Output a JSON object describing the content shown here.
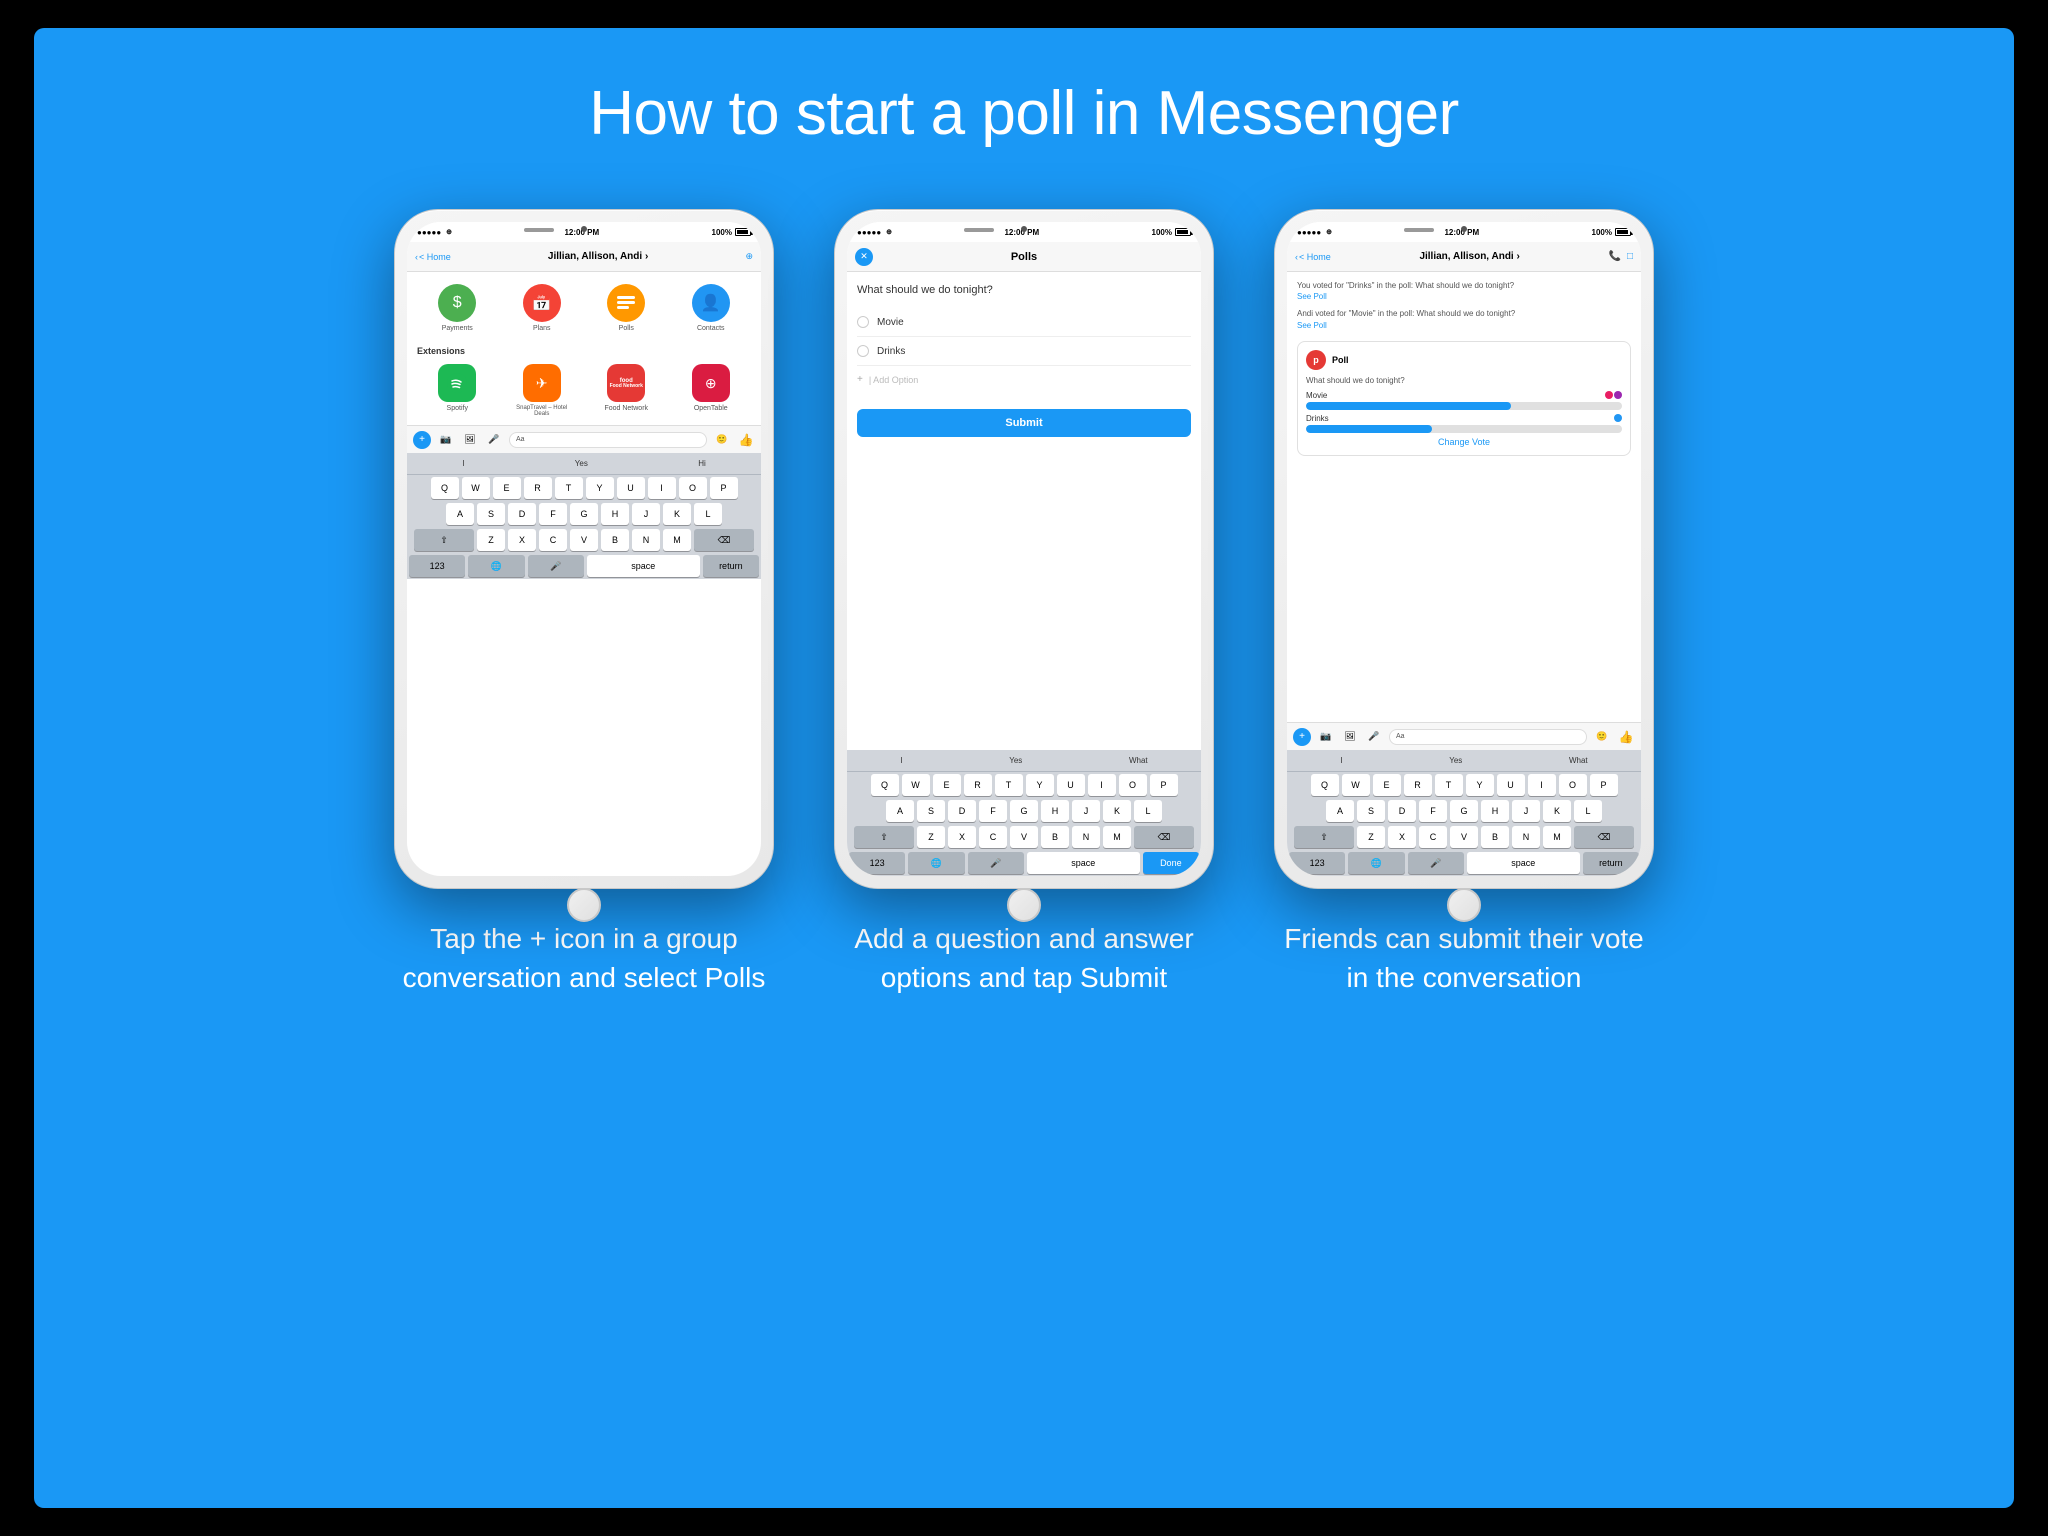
{
  "page": {
    "title": "How to start a poll in Messenger",
    "bg_color": "#1a98f5"
  },
  "phones": [
    {
      "id": "phone1",
      "caption": "Tap the + icon in a group conversation and select Polls",
      "status": {
        "left": "●●●●● ⊕",
        "time": "12:00 PM",
        "right": "100%"
      },
      "nav": {
        "back": "< Home",
        "title": "Jillian, Allison, Andi ›",
        "icons": "⊕"
      },
      "main_icons": [
        {
          "label": "Payments",
          "color": "#4caf50",
          "icon": "$"
        },
        {
          "label": "Plans",
          "color": "#f44336",
          "icon": "📅"
        },
        {
          "label": "Polls",
          "color": "#ff9800",
          "icon": "≡"
        },
        {
          "label": "Contacts",
          "color": "#2196f3",
          "icon": "👤"
        }
      ],
      "extensions_label": "Extensions",
      "extensions": [
        {
          "label": "Spotify",
          "color": "#1db954",
          "icon": "♫"
        },
        {
          "label": "SnapTravel – Hotel Deals",
          "color": "#ff6d00",
          "icon": "✈"
        },
        {
          "label": "Food Network",
          "color": "#e53935",
          "icon": "food"
        },
        {
          "label": "OpenTable",
          "color": "#da1c41",
          "icon": "⊕"
        }
      ],
      "keyboard": {
        "suggestions": [
          "I",
          "Yes",
          "Hi"
        ],
        "rows": [
          [
            "Q",
            "W",
            "E",
            "R",
            "T",
            "Y",
            "U",
            "I",
            "O",
            "P"
          ],
          [
            "A",
            "S",
            "D",
            "F",
            "G",
            "H",
            "J",
            "K",
            "L"
          ],
          [
            "⇧",
            "Z",
            "X",
            "C",
            "V",
            "B",
            "N",
            "M",
            "⌫"
          ],
          [
            "123",
            "🌐",
            "🎤",
            "space",
            "return"
          ]
        ]
      }
    },
    {
      "id": "phone2",
      "caption": "Add a question and answer options and tap Submit",
      "status": {
        "left": "●●●●● ⊕",
        "time": "12:00 PM",
        "right": "100%"
      },
      "polls_title": "Polls",
      "question": "What should we do tonight?",
      "options": [
        "Movie",
        "Drinks"
      ],
      "add_placeholder": "+ | Add Option",
      "submit_label": "Submit",
      "keyboard": {
        "suggestions": [
          "I",
          "Yes",
          "What"
        ],
        "rows": [
          [
            "Q",
            "W",
            "E",
            "R",
            "T",
            "Y",
            "U",
            "I",
            "O",
            "P"
          ],
          [
            "A",
            "S",
            "D",
            "F",
            "G",
            "H",
            "J",
            "K",
            "L"
          ],
          [
            "⇧",
            "Z",
            "X",
            "C",
            "V",
            "B",
            "N",
            "M",
            "⌫"
          ],
          [
            "123",
            "🌐",
            "🎤",
            "space",
            "Done"
          ]
        ]
      }
    },
    {
      "id": "phone3",
      "caption": "Friends can submit their vote in the conversation",
      "status": {
        "left": "●●●●● ⊕",
        "time": "12:00 PM",
        "right": "100%"
      },
      "nav": {
        "back": "< Home",
        "title": "Jillian, Allison, Andi ›",
        "icons": "📞 □"
      },
      "messages": [
        "You voted for \"Drinks\" in the poll: What should we do tonight? See Poll",
        "Andi voted for \"Movie\" in the poll: What should we do tonight? See Poll"
      ],
      "poll_card": {
        "badge": "p",
        "label": "Poll",
        "question": "What should we do tonight?",
        "options": [
          {
            "label": "Movie",
            "fill": 65
          },
          {
            "label": "Drinks",
            "fill": 40
          }
        ],
        "change_vote": "Change Vote"
      },
      "keyboard": {
        "suggestions": [
          "I",
          "Yes",
          "What"
        ],
        "rows": [
          [
            "Q",
            "W",
            "E",
            "R",
            "T",
            "Y",
            "U",
            "I",
            "O",
            "P"
          ],
          [
            "A",
            "S",
            "D",
            "F",
            "G",
            "H",
            "J",
            "K",
            "L"
          ],
          [
            "⇧",
            "Z",
            "X",
            "C",
            "V",
            "B",
            "N",
            "M",
            "⌫"
          ],
          [
            "123",
            "🌐",
            "🎤",
            "space",
            "return"
          ]
        ]
      }
    }
  ]
}
